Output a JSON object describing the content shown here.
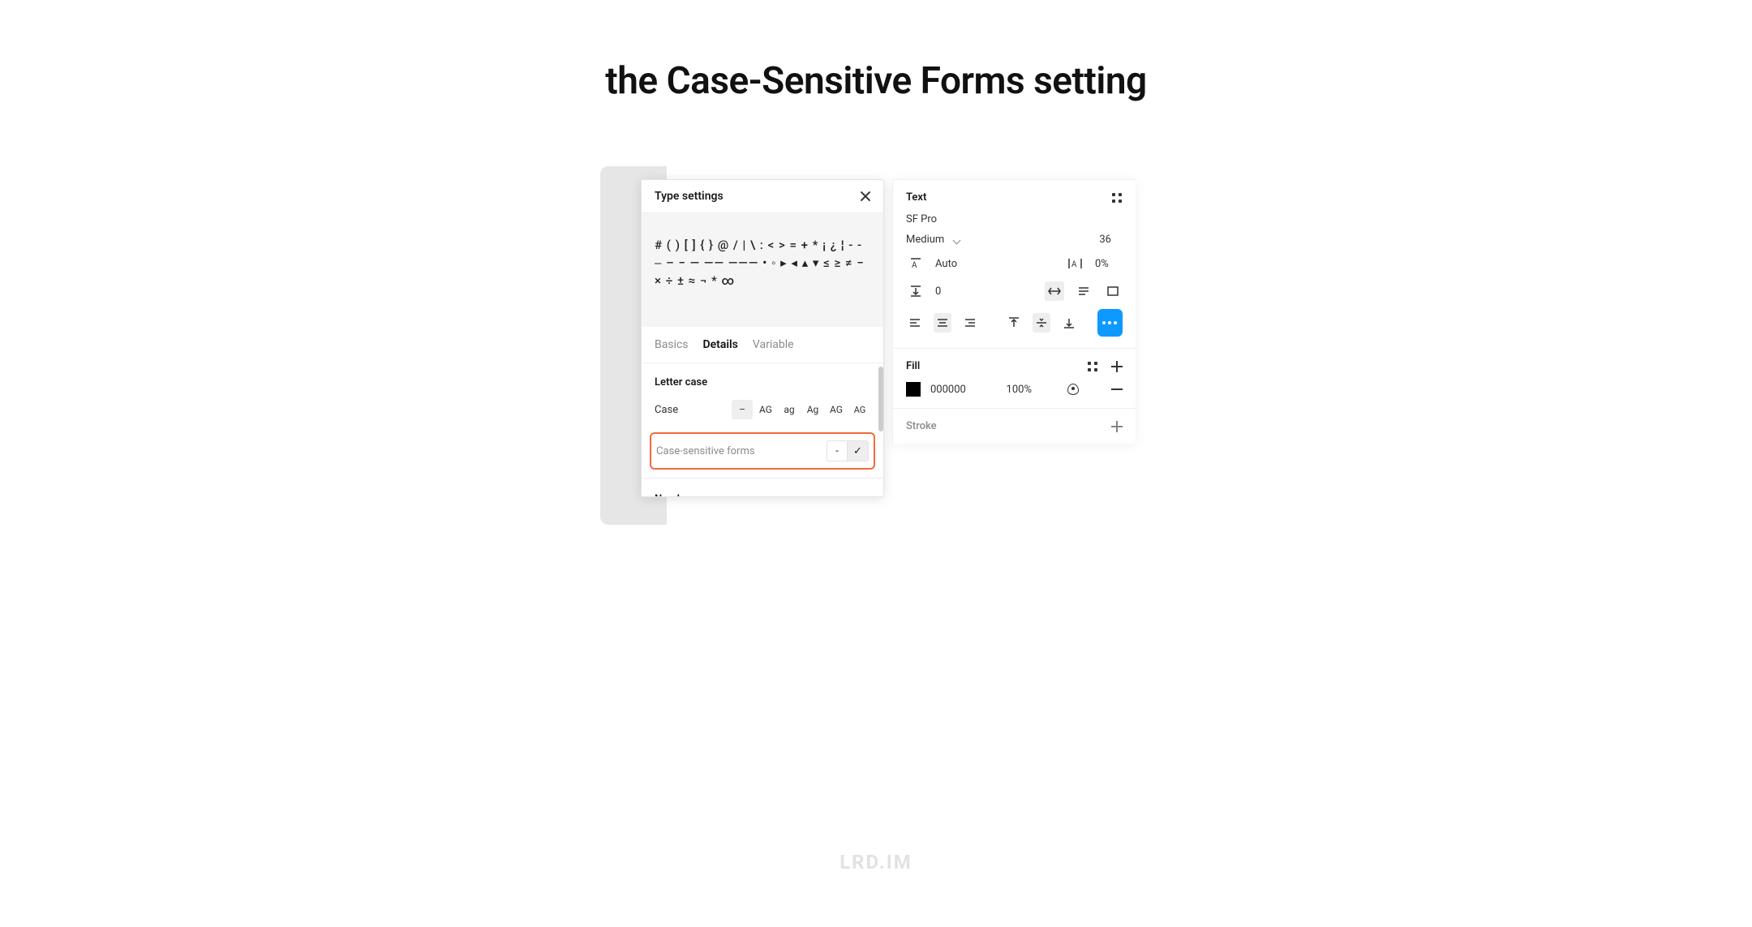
{
  "pageTitle": "the Case-Sensitive Forms setting",
  "watermark": "LRD.IM",
  "typeSettings": {
    "title": "Type settings",
    "preview": "# ( ) [ ] { } @ / | \\ : < > = + * ¡ ¿ ¦ ‐ - ‒ – − — ―― ――― • ◦ ▸ ◂ ▴ ▾ ≤ ≥ ≠ − × ÷ ± ≈ ¬ * ∞",
    "tabs": {
      "basics": "Basics",
      "details": "Details",
      "variable": "Variable"
    },
    "letterCase": {
      "heading": "Letter case",
      "caseLabel": "Case",
      "options": {
        "dash": "–",
        "upper": "AG",
        "lower": "ag",
        "title": "Ag",
        "small1": "AG",
        "small2": "AG"
      },
      "csfLabel": "Case-sensitive forms",
      "csfDash": "-",
      "csfCheck": "✓"
    },
    "numbersHeading": "Numbers"
  },
  "inspector": {
    "textHeading": "Text",
    "font": "SF Pro",
    "weight": "Medium",
    "size": "36",
    "lineHeight": "Auto",
    "letterSpacing": "0%",
    "paragraphSpacing": "0",
    "fillHeading": "Fill",
    "fillHex": "000000",
    "fillOpacity": "100%",
    "strokeHeading": "Stroke"
  }
}
